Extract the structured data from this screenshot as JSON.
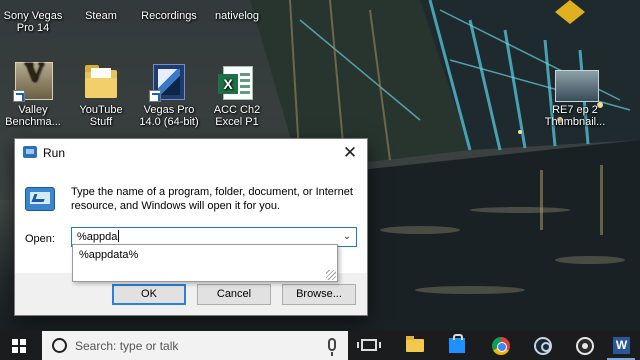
{
  "desktop": {
    "icons": [
      {
        "label": "Sony Vegas Pro 14",
        "icon": "sony-vegas-icon"
      },
      {
        "label": "Steam",
        "icon": "steam-icon"
      },
      {
        "label": "Recordings",
        "icon": "folder-icon"
      },
      {
        "label": "nativelog",
        "icon": "file-icon"
      },
      {
        "label": "Valley Benchma...",
        "icon": "valley-benchmark-icon"
      },
      {
        "label": "YouTube Stuff",
        "icon": "folder-icon"
      },
      {
        "label": "Vegas Pro 14.0 (64-bit)",
        "icon": "vegas-pro-icon"
      },
      {
        "label": "ACC Ch2 Excel P1",
        "icon": "excel-icon"
      },
      {
        "label": "RE7 ep 2 Thumbnail...",
        "icon": "image-thumbnail-icon"
      }
    ]
  },
  "run_dialog": {
    "title": "Run",
    "close_glyph": "✕",
    "instructions": "Type the name of a program, folder, document, or Internet resource, and Windows will open it for you.",
    "open_label": "Open:",
    "open_value": "%appda",
    "dropdown_glyph": "⌄",
    "autocomplete": [
      "%appdata%"
    ],
    "buttons": {
      "ok": "OK",
      "cancel": "Cancel",
      "browse": "Browse..."
    }
  },
  "taskbar": {
    "search_placeholder": "Search: type or talk",
    "pinned": [
      "task-view-icon",
      "file-explorer-icon",
      "store-icon",
      "chrome-icon",
      "steam-icon",
      "obs-icon",
      "word-icon"
    ]
  },
  "colors": {
    "accent": "#2b7fd6",
    "taskbar": "#1b1c1e",
    "dialog_footer": "#f0f0f0"
  }
}
